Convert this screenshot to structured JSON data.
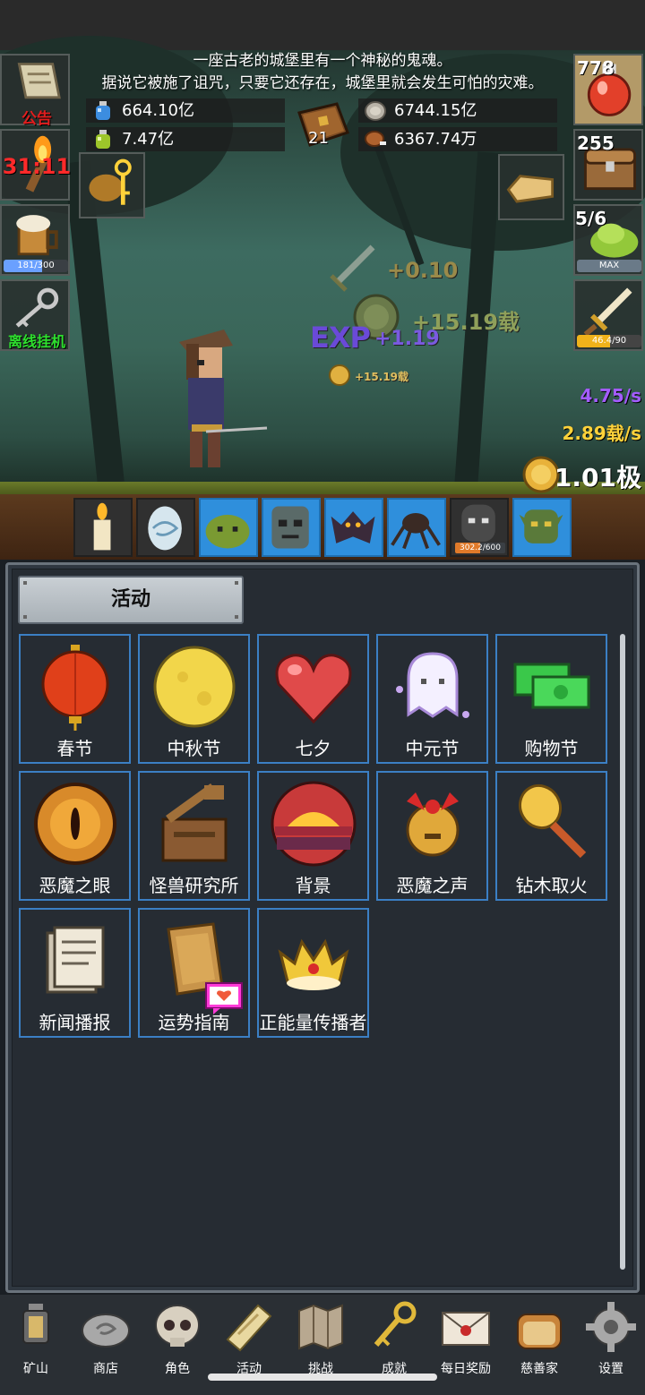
{
  "story": {
    "line1": "一座古老的城堡里有一个神秘的鬼魂。",
    "line2": "据说它被施了诅咒，只要它还存在，城堡里就会发生可怕的灾难。"
  },
  "resources": {
    "blue_potion": "664.10亿",
    "green_potion": "7.47亿",
    "book_level": "21",
    "silver_coin": "6744.15亿",
    "meat": "6367.74万"
  },
  "left_side": {
    "notice_label": "公告",
    "torch_value": "31:11",
    "beer_progress_text": "181/300",
    "beer_progress": 0.603,
    "offline_label": "离线挂机"
  },
  "right_side": {
    "potion_count": "778",
    "chest_count": "255",
    "slime_count": "5/6",
    "slime_badge": "MAX",
    "sword_progress_text": "46.4/90",
    "sword_progress": 0.516
  },
  "effects": {
    "sword_gain": "+0.10",
    "coin_gain": "+15.19载",
    "exp_label": "EXP",
    "exp_gain": "+1.19",
    "small_coin_gain": "+15.19载"
  },
  "rates": {
    "exp_rate": "4.75/s",
    "gold_rate": "2.89载/s",
    "gold_total": "1.01极"
  },
  "monsters": [
    {
      "name": "candle",
      "dark": true
    },
    {
      "name": "egg",
      "dark": true
    },
    {
      "name": "slime",
      "dark": false
    },
    {
      "name": "zombie",
      "dark": false
    },
    {
      "name": "bat",
      "dark": false
    },
    {
      "name": "spider",
      "dark": false
    },
    {
      "name": "ghost",
      "dark": true,
      "progress_text": "302.2/600",
      "progress": 0.504
    },
    {
      "name": "orc",
      "dark": false
    }
  ],
  "panel": {
    "title": "活动",
    "tiles": [
      {
        "label": "春节",
        "icon": "lantern-icon"
      },
      {
        "label": "中秋节",
        "icon": "moon-icon"
      },
      {
        "label": "七夕",
        "icon": "heart-icon"
      },
      {
        "label": "中元节",
        "icon": "ghost-icon"
      },
      {
        "label": "购物节",
        "icon": "cash-icon"
      },
      {
        "label": "恶魔之眼",
        "icon": "demon-eye-icon"
      },
      {
        "label": "怪兽研究所",
        "icon": "lab-icon"
      },
      {
        "label": "背景",
        "icon": "sunset-icon"
      },
      {
        "label": "恶魔之声",
        "icon": "bell-icon"
      },
      {
        "label": "钻木取火",
        "icon": "torch-stick-icon"
      },
      {
        "label": "新闻播报",
        "icon": "newspaper-icon"
      },
      {
        "label": "运势指南",
        "icon": "fortune-card-icon"
      },
      {
        "label": "正能量传播者",
        "icon": "crown-icon"
      }
    ]
  },
  "nav": [
    {
      "label": "矿山",
      "icon": "lantern-nav-icon"
    },
    {
      "label": "商店",
      "icon": "stone-nav-icon"
    },
    {
      "label": "角色",
      "icon": "skull-nav-icon"
    },
    {
      "label": "活动",
      "icon": "scroll-nav-icon"
    },
    {
      "label": "挑战",
      "icon": "map-nav-icon"
    },
    {
      "label": "成就",
      "icon": "key-nav-icon"
    },
    {
      "label": "每日奖励",
      "icon": "envelope-nav-icon"
    },
    {
      "label": "慈善家",
      "icon": "bread-nav-icon"
    },
    {
      "label": "设置",
      "icon": "gear-nav-icon"
    }
  ],
  "colors": {
    "tile_border": "#3b7fc4",
    "exp_purple": "#a35cff",
    "gold": "#ffd23a",
    "notice_red": "#e01e1e",
    "offline_green": "#2ee02e"
  }
}
